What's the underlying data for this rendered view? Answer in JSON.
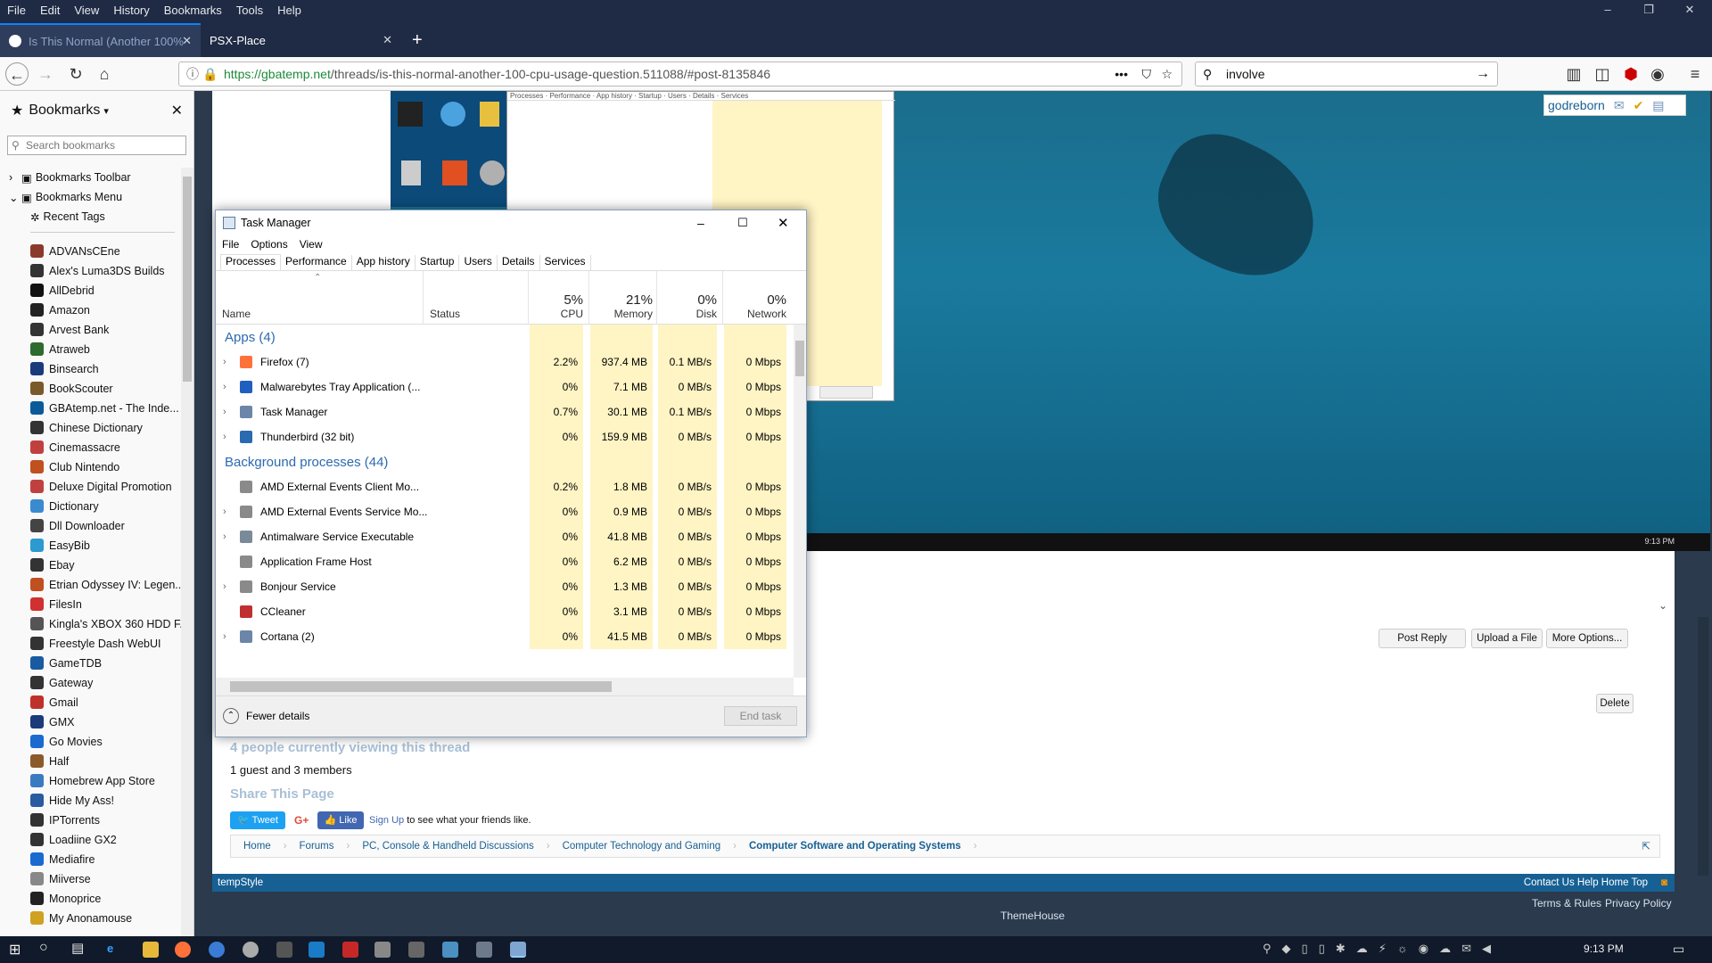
{
  "menubar": {
    "items": [
      "File",
      "Edit",
      "View",
      "History",
      "Bookmarks",
      "Tools",
      "Help"
    ]
  },
  "tabs": [
    {
      "title": "Is This Normal (Another 100%"
    },
    {
      "title": "PSX-Place"
    }
  ],
  "address": {
    "url_host": "https://gbatemp.net",
    "url_path": "/threads/is-this-normal-another-100-cpu-usage-question.511088/#post-8135846"
  },
  "search": {
    "value": "involve"
  },
  "sidebar": {
    "title": "Bookmarks",
    "search_placeholder": "Search bookmarks",
    "folders": [
      "Bookmarks Toolbar",
      "Bookmarks Menu",
      "Recent Tags"
    ],
    "items": [
      "ADVANsCEne",
      "Alex's Luma3DS Builds",
      "AllDebrid",
      "Amazon",
      "Arvest Bank",
      "Atraweb",
      "Binsearch",
      "BookScouter",
      "GBAtemp.net - The Inde...",
      "Chinese Dictionary",
      "Cinemassacre",
      "Club Nintendo",
      "Deluxe Digital Promotion",
      "Dictionary",
      "Dll Downloader",
      "EasyBib",
      "Ebay",
      "Etrian Odyssey IV: Legen...",
      "FilesIn",
      "Kingla's XBOX 360 HDD F...",
      "Freestyle Dash WebUI",
      "GameTDB",
      "Gateway",
      "Gmail",
      "GMX",
      "Go Movies",
      "Half",
      "Homebrew App Store",
      "Hide My Ass!",
      "IPTorrents",
      "Loadiine GX2",
      "Mediafire",
      "Miiverse",
      "Monoprice",
      "My Anonamouse"
    ]
  },
  "post": {
    "user": "godreborn",
    "buttons": [
      "Post Reply",
      "Upload a File",
      "More Options..."
    ],
    "delete": "Delete",
    "viewing": "4 people currently viewing this thread",
    "members": "1 guest and 3 members",
    "share": "Share This Page",
    "tweet": "Tweet",
    "like": "Like",
    "signup": "Sign Up",
    "signup_rest": " to see what your friends like.",
    "breadcrumb": [
      "Home",
      "Forums",
      "PC, Console & Handheld Discussions",
      "Computer Technology and Gaming",
      "Computer Software and Operating Systems"
    ],
    "style": "tempStyle",
    "footer_links": "Contact Us  Help  Home  Top",
    "terms": "Terms & Rules",
    "privacy": "Privacy Policy",
    "theme": "ThemeHouse"
  },
  "taskmanager": {
    "title": "Task Manager",
    "menu": [
      "File",
      "Options",
      "View"
    ],
    "tabs": [
      "Processes",
      "Performance",
      "App history",
      "Startup",
      "Users",
      "Details",
      "Services"
    ],
    "cols": {
      "name": "Name",
      "status": "Status",
      "cpu": "CPU",
      "memory": "Memory",
      "disk": "Disk",
      "network": "Network"
    },
    "totals": {
      "cpu": "5%",
      "memory": "21%",
      "disk": "0%",
      "network": "0%"
    },
    "apps_header": "Apps (4)",
    "bg_header": "Background processes (44)",
    "apps": [
      {
        "name": "Firefox (7)",
        "cpu": "2.2%",
        "mem": "937.4 MB",
        "disk": "0.1 MB/s",
        "net": "0 Mbps"
      },
      {
        "name": "Malwarebytes Tray Application (...",
        "cpu": "0%",
        "mem": "7.1 MB",
        "disk": "0 MB/s",
        "net": "0 Mbps"
      },
      {
        "name": "Task Manager",
        "cpu": "0.7%",
        "mem": "30.1 MB",
        "disk": "0.1 MB/s",
        "net": "0 Mbps"
      },
      {
        "name": "Thunderbird (32 bit)",
        "cpu": "0%",
        "mem": "159.9 MB",
        "disk": "0 MB/s",
        "net": "0 Mbps"
      }
    ],
    "bg": [
      {
        "name": "AMD External Events Client Mo...",
        "cpu": "0.2%",
        "mem": "1.8 MB",
        "disk": "0 MB/s",
        "net": "0 Mbps"
      },
      {
        "name": "AMD External Events Service Mo...",
        "cpu": "0%",
        "mem": "0.9 MB",
        "disk": "0 MB/s",
        "net": "0 Mbps"
      },
      {
        "name": "Antimalware Service Executable",
        "cpu": "0%",
        "mem": "41.8 MB",
        "disk": "0 MB/s",
        "net": "0 Mbps"
      },
      {
        "name": "Application Frame Host",
        "cpu": "0%",
        "mem": "6.2 MB",
        "disk": "0 MB/s",
        "net": "0 Mbps"
      },
      {
        "name": "Bonjour Service",
        "cpu": "0%",
        "mem": "1.3 MB",
        "disk": "0 MB/s",
        "net": "0 Mbps"
      },
      {
        "name": "CCleaner",
        "cpu": "0%",
        "mem": "3.1 MB",
        "disk": "0 MB/s",
        "net": "0 Mbps"
      },
      {
        "name": "Cortana (2)",
        "cpu": "0%",
        "mem": "41.5 MB",
        "disk": "0 MB/s",
        "net": "0 Mbps"
      }
    ],
    "fewer": "Fewer details",
    "end_task": "End task"
  },
  "clock": "9:13 PM"
}
